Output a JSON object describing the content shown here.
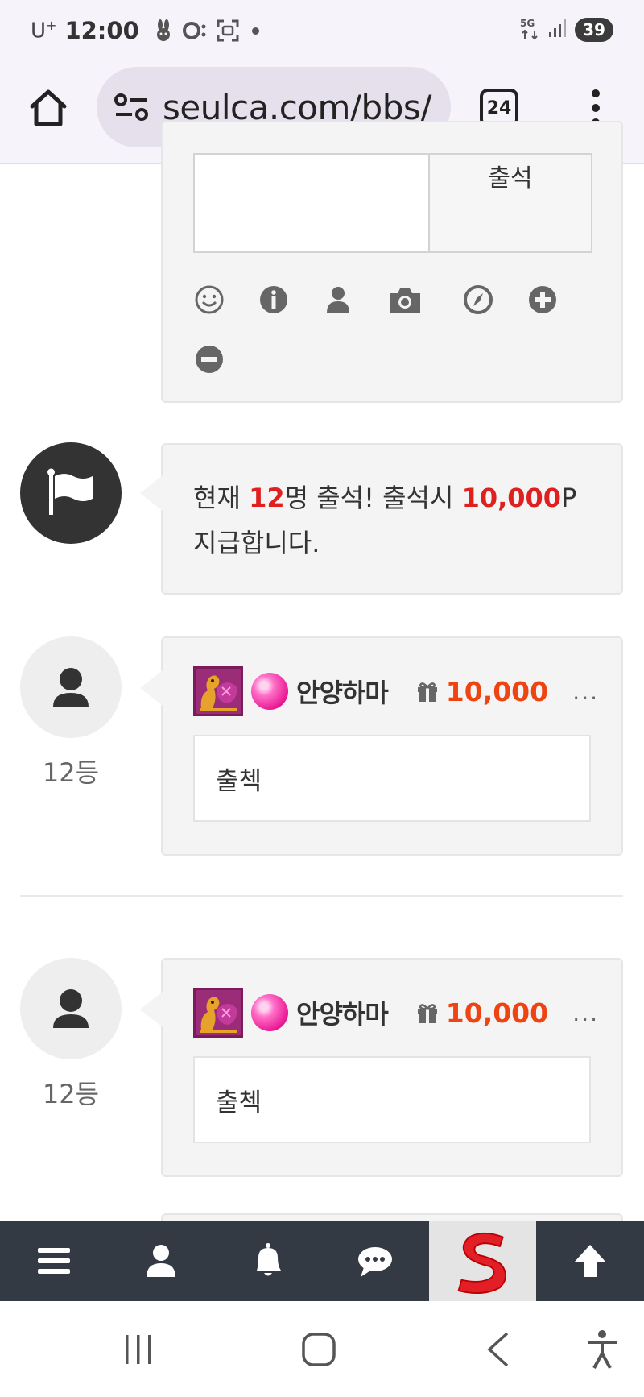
{
  "status_bar": {
    "carrier": "U",
    "carrier_plus": "+",
    "time": "12:00",
    "network": "5G",
    "battery": "39"
  },
  "browser": {
    "url": "seulca.com/bbs/",
    "tab_count": "24"
  },
  "comment_form": {
    "submit_label": "출석",
    "tools": [
      "smile-icon",
      "info-icon",
      "user-icon",
      "camera-icon",
      "compass-icon",
      "plus-circle-icon",
      "minus-circle-icon"
    ]
  },
  "notice": {
    "prefix": "현재 ",
    "count": "12",
    "middle": "명 출석! 출석시 ",
    "points": "10,000",
    "suffix": "P",
    "line2": "지급합니다."
  },
  "comments": [
    {
      "rank": "12등",
      "nickname": "안양하마",
      "points": "10,000",
      "more": "...",
      "body": "출첵"
    },
    {
      "rank": "12등",
      "nickname": "안양하마",
      "points": "10,000",
      "more": "...",
      "body": "출첵"
    }
  ],
  "bottom_nav": [
    "menu-icon",
    "user-icon",
    "bell-icon",
    "chat-icon",
    "site-logo",
    "arrow-up-icon"
  ],
  "colors": {
    "accent_red": "#e0201f",
    "points_orange": "#ee4411",
    "nav_bg": "#333a43",
    "logo_red": "#e21f26"
  }
}
